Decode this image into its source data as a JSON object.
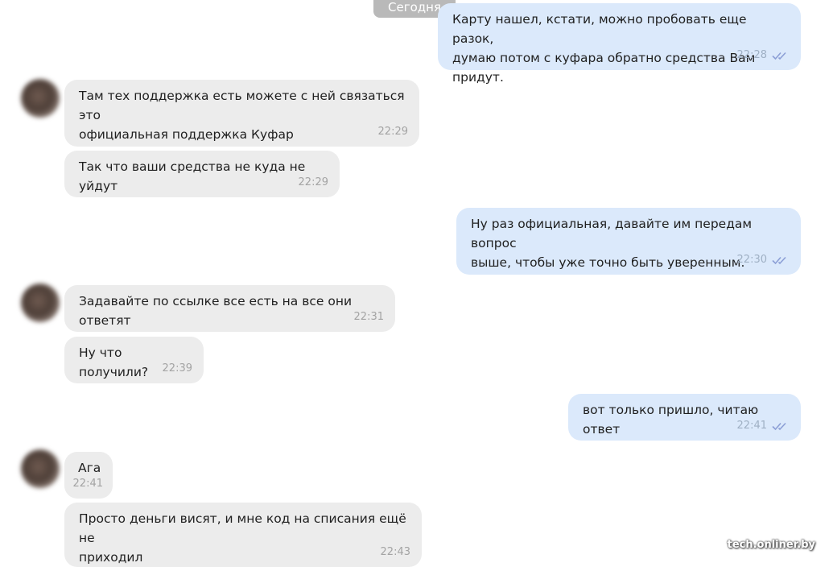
{
  "date_separator": "Сегодня",
  "messages": [
    {
      "dir": "out",
      "text": "Карту нашел, кстати, можно пробовать еще разок,\nдумаю потом с куфара обратно средства Вам придут.",
      "time": "22:28"
    },
    {
      "dir": "in",
      "text": "Там тех поддержка есть можете с ней связаться это\nофициальная поддержка Куфар",
      "time": "22:29"
    },
    {
      "dir": "in",
      "text": "Так что ваши средства не куда не уйдут",
      "time": "22:29"
    },
    {
      "dir": "out",
      "text": "Ну раз официальная, давайте им передам вопрос\nвыше, чтобы уже точно быть уверенным.",
      "time": "22:30"
    },
    {
      "dir": "in",
      "text": "Задавайте по ссылке все есть на все они ответят",
      "time": "22:31"
    },
    {
      "dir": "in",
      "text": "Ну что получили?",
      "time": "22:39"
    },
    {
      "dir": "out",
      "text": "вот только пришло, читаю ответ",
      "time": "22:41"
    },
    {
      "dir": "in",
      "text": "Ага",
      "time": "22:41"
    },
    {
      "dir": "in",
      "text": "Просто деньги висят, и мне код на списания ещё не\nприходил",
      "time": "22:43"
    }
  ],
  "watermark": "tech.onliner.by",
  "colors": {
    "incoming_bubble": "#ececec",
    "outgoing_bubble": "#dbe9fb",
    "read_ticks": "#8c9fd6"
  },
  "icons": {
    "read_status": "double-check-icon",
    "avatar": "blurred-avatar"
  }
}
